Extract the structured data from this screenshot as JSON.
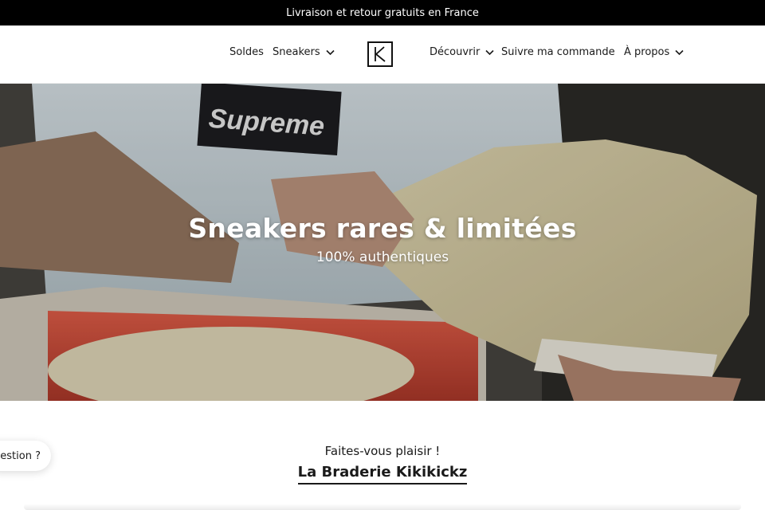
{
  "announcement": {
    "text": "Livraison et retour gratuits en France"
  },
  "nav": {
    "soldes": "Soldes",
    "sneakers": "Sneakers",
    "decouvrir": "Découvrir",
    "suivre": "Suivre ma commande",
    "apropos": "À propos",
    "logo_icon": "kikikickz-logo-icon",
    "chevron_icon": "chevron-down-icon"
  },
  "hero": {
    "title": "Sneakers rares & limitées",
    "subtitle": "100% authentiques",
    "supreme_label": "Supreme"
  },
  "section": {
    "kicker": "Faites-vous plaisir !",
    "title": "La Braderie Kikikickz"
  },
  "chat": {
    "label": "Une question ?"
  },
  "colors": {
    "announcement_bg": "#000000",
    "text": "#1a1a1a",
    "hero_text": "#ffffff"
  }
}
